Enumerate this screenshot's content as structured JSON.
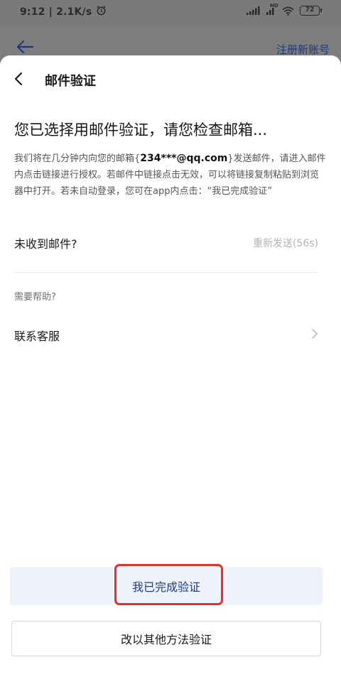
{
  "status_bar": {
    "time_speed": "9:12 | 2.1K/s",
    "alarm_icon": "alarm-clock-icon",
    "signal_icon": "cellular-signal-icon",
    "hd_badge": "HD",
    "wifi_icon": "wifi-icon",
    "battery": "72"
  },
  "background_page": {
    "back_icon": "arrow-left-icon",
    "register_link": "注册新账号"
  },
  "sheet": {
    "back_icon": "chevron-left-icon",
    "title": "邮件验证",
    "headline": "您已选择用邮件验证，请您检查邮箱...",
    "description": {
      "part1": "我们将在几分钟内向您的邮箱{",
      "email": "234***@qq.com",
      "part2": "}发送邮件，请进入邮件内点击链接进行授权。若邮件中链接点击无效，可以将链接复制粘贴到浏览器中打开。若未自动登录，您可在app内点击：“我已完成验证”"
    },
    "no_mail_label": "未收到邮件?",
    "resend_label": "重新发送(56s)",
    "help_label": "需要帮助?",
    "contact_label": "联系客服",
    "done_button": "我已完成验证",
    "other_method_button": "改以其他方法验证"
  },
  "colors": {
    "accent": "#1e3c86",
    "highlight": "#e2322b",
    "overlay": "#7d7d7d"
  }
}
